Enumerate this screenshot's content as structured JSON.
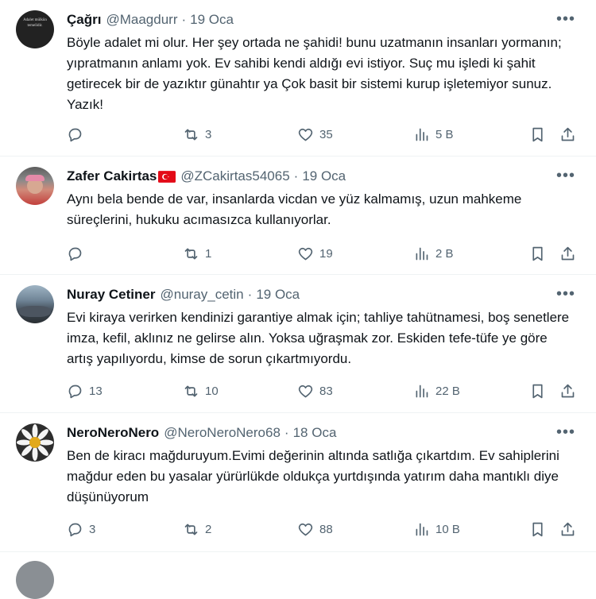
{
  "tweets": [
    {
      "name": "Çağrı",
      "handle": "@Maagdurr",
      "date": "19 Oca",
      "avatar_text": "Adalet mülkün temelidir.",
      "text": "Böyle adalet mi olur. Her şey ortada ne şahidi! bunu uzatmanın insanları yormanın; yıpratmanın anlamı yok. Ev sahibi kendi aldığı evi istiyor. Suç mu işledi ki şahit getirecek bir de yazıktır günahtır ya  Çok basit bir sistemi kurup işletemiyor sunuz. Yazık!",
      "replies": "",
      "retweets": "3",
      "likes": "35",
      "views": "5 B"
    },
    {
      "name": "Zafer Cakirtas",
      "flag": "turkey-flag-icon",
      "handle": "@ZCakirtas54065",
      "date": "19 Oca",
      "text": "Aynı bela bende de var, insanlarda vicdan ve yüz kalmamış, uzun mahkeme süreçlerini, hukuku acımasızca kullanıyorlar.",
      "replies": "",
      "retweets": "1",
      "likes": "19",
      "views": "2 B"
    },
    {
      "name": "Nuray Cetiner",
      "handle": "@nuray_cetin",
      "date": "19 Oca",
      "text": "Evi kiraya verirken kendinizi garantiye almak için; tahliye tahütnamesi, boş senetlere imza, kefil, aklınız ne gelirse alın. Yoksa uğraşmak zor. Eskiden tefe-tüfe ye göre artış yapılıyordu, kimse de sorun çıkartmıyordu.",
      "replies": "13",
      "retweets": "10",
      "likes": "83",
      "views": "22 B"
    },
    {
      "name": "NeroNeroNero",
      "handle": "@NeroNeroNero68",
      "date": "18 Oca",
      "text": "Ben de kiracı mağduruyum.Evimi değerinin altında satlığa çıkartdım. Ev sahiplerini mağdur eden bu yasalar yürürlükde oldukça yurtdışında yatırım daha mantıklı diye düşünüyorum",
      "replies": "3",
      "retweets": "2",
      "likes": "88",
      "views": "10 B"
    }
  ],
  "separator": "·",
  "more_glyph": "•••"
}
